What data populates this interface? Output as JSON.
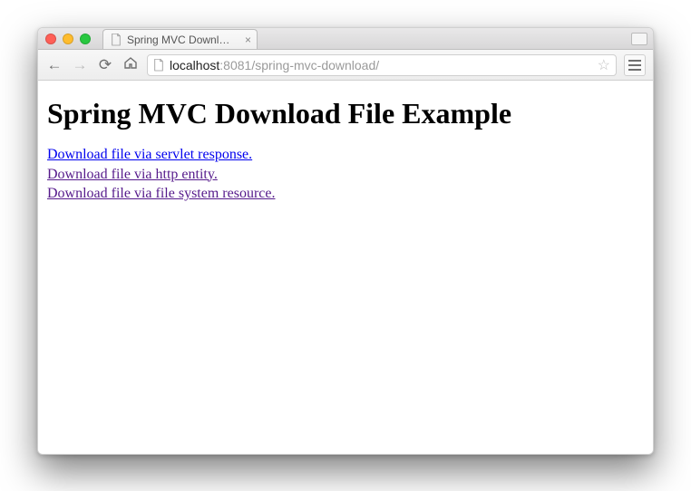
{
  "tab": {
    "title": "Spring MVC Download File"
  },
  "urlbar": {
    "host": "localhost",
    "port": ":8081",
    "path": "/spring-mvc-download/"
  },
  "page": {
    "heading": "Spring MVC Download File Example",
    "links": [
      "Download file via servlet response.",
      "Download file via http entity.",
      "Download file via file system resource."
    ]
  }
}
